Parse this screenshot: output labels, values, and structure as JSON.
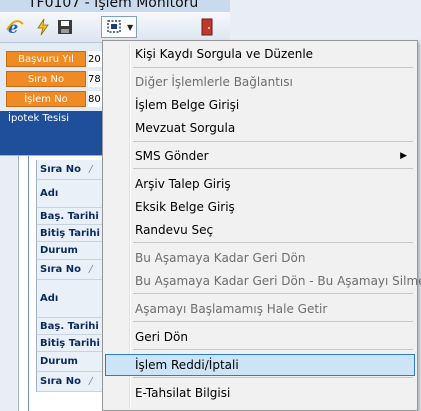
{
  "window": {
    "title": "TF0107 - İşlem Monitörü"
  },
  "toolbar": {
    "icons": [
      "ie-icon",
      "lightning-icon",
      "save-icon",
      "menu-grid-icon",
      "door-icon"
    ]
  },
  "info": {
    "basvuru_yil_label": "Başvuru Yıl",
    "basvuru_yil_value": "20",
    "sira_no_label": "Sıra No",
    "sira_no_value": "78",
    "islem_no_label": "İşlem No",
    "islem_no_value": "80",
    "ipotek_label": "İpotek Tesisi"
  },
  "grid": {
    "rows": [
      {
        "label": "Sıra No",
        "sort": "/"
      },
      {
        "label": "Adı",
        "sort": ""
      },
      {
        "label": "Baş. Tarihi",
        "sort": ""
      },
      {
        "label": "Bitiş Tarihi",
        "sort": ""
      },
      {
        "label": "Durum",
        "sort": ""
      },
      {
        "label": "Sıra No",
        "sort": "/"
      },
      {
        "label": "Adı",
        "sort": ""
      },
      {
        "label": "Baş. Tarihi",
        "sort": ""
      },
      {
        "label": "Bitiş Tarihi",
        "sort": ""
      },
      {
        "label": "Durum",
        "sort": ""
      },
      {
        "label": "Sıra No",
        "sort": "/"
      }
    ]
  },
  "menu": {
    "items": [
      {
        "label": "Kişi Kaydı Sorgula ve Düzenle",
        "state": "enabled"
      },
      {
        "label": "Diğer İşlemlerle Bağlantısı",
        "state": "disabled"
      },
      {
        "label": "İşlem Belge Girişi",
        "state": "enabled"
      },
      {
        "label": "Mevzuat Sorgula",
        "state": "enabled"
      },
      {
        "label": "SMS Gönder",
        "state": "enabled",
        "submenu": true
      },
      {
        "label": "Arşiv Talep Giriş",
        "state": "enabled"
      },
      {
        "label": "Eksik Belge Giriş",
        "state": "enabled"
      },
      {
        "label": "Randevu Seç",
        "state": "enabled"
      },
      {
        "label": "Bu Aşamaya Kadar Geri Dön",
        "state": "disabled"
      },
      {
        "label": "Bu Aşamaya Kadar Geri Dön - Bu Aşamayı Silme",
        "state": "disabled"
      },
      {
        "label": "Aşamayı Başlamamış Hale Getir",
        "state": "disabled"
      },
      {
        "label": "Geri Dön",
        "state": "enabled"
      },
      {
        "label": "İşlem Reddi/İptali",
        "state": "highlighted"
      },
      {
        "label": "E-Tahsilat Bilgisi",
        "state": "enabled"
      }
    ],
    "highlight_color": "#cce4f7",
    "highlight_border": "#2c7dcd"
  },
  "colors": {
    "field_label_bg": "#f08a24",
    "panel_header_bg": "#1f4e9a",
    "grid_text": "#0b2a5c"
  }
}
